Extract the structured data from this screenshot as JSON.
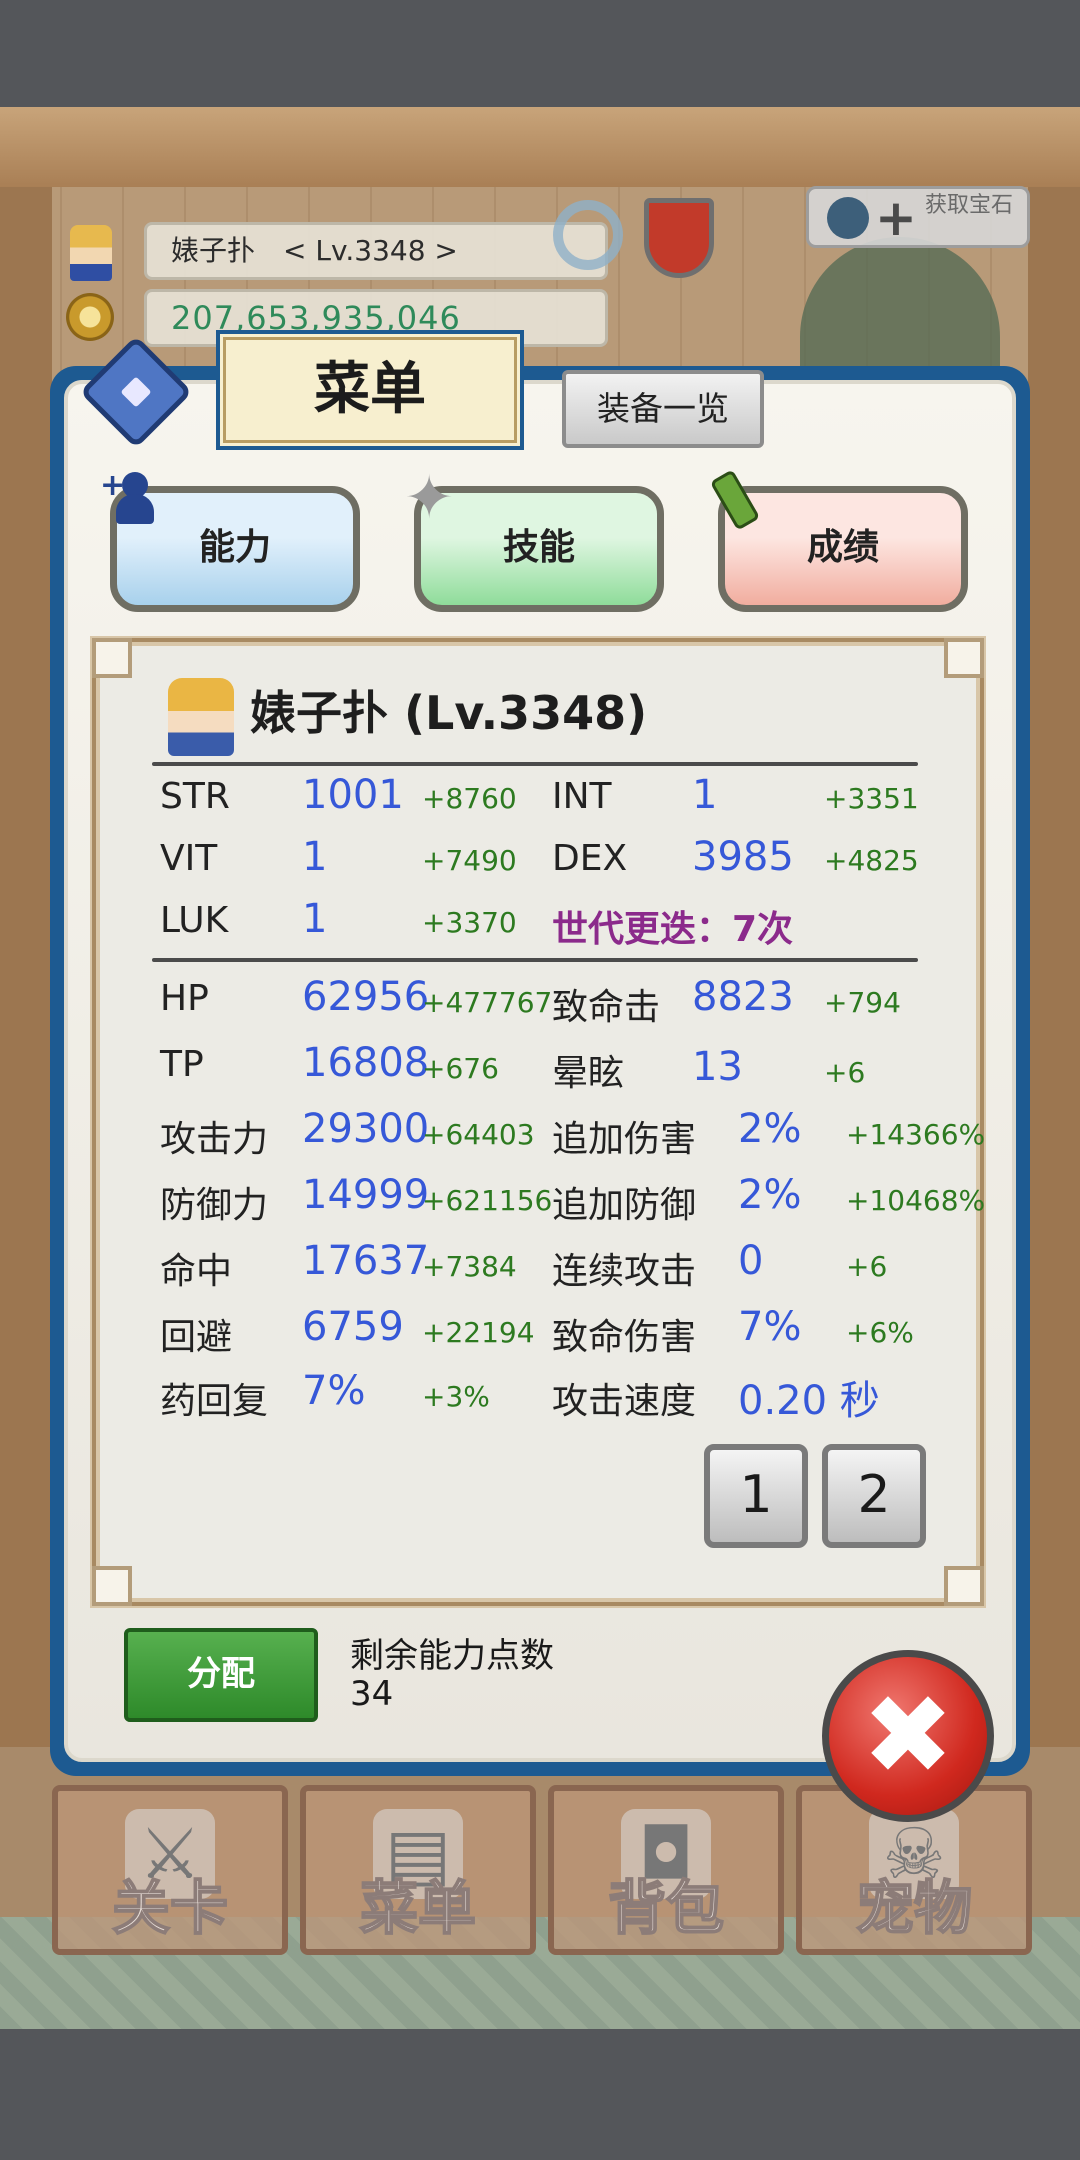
{
  "hud": {
    "player_name": "婊子扑　< Lv.3348 >",
    "gold": "207,653,935,046",
    "gem_button_label": "获取宝石"
  },
  "menu": {
    "title": "菜单",
    "equip_list_button": "装备一览",
    "tabs": [
      {
        "label": "能力"
      },
      {
        "label": "技能"
      },
      {
        "label": "成绩"
      }
    ]
  },
  "character": {
    "title": "婊子扑 (Lv.3348)"
  },
  "stats": {
    "str": {
      "label": "STR",
      "value": "1001",
      "bonus": "+8760"
    },
    "int": {
      "label": "INT",
      "value": "1",
      "bonus": "+3351"
    },
    "vit": {
      "label": "VIT",
      "value": "1",
      "bonus": "+7490"
    },
    "dex": {
      "label": "DEX",
      "value": "3985",
      "bonus": "+4825"
    },
    "luk": {
      "label": "LUK",
      "value": "1",
      "bonus": "+3370"
    },
    "generation": "世代更迭：7次",
    "hp": {
      "label": "HP",
      "value": "62956",
      "bonus": "+477767"
    },
    "crit": {
      "label": "致命击",
      "value": "8823",
      "bonus": "+794"
    },
    "tp": {
      "label": "TP",
      "value": "16808",
      "bonus": "+676"
    },
    "stun": {
      "label": "晕眩",
      "value": "13",
      "bonus": "+6"
    },
    "atk": {
      "label": "攻击力",
      "value": "29300",
      "bonus": "+64403"
    },
    "extra_dmg": {
      "label": "追加伤害",
      "value": "2%",
      "bonus": "+14366%"
    },
    "def": {
      "label": "防御力",
      "value": "14999",
      "bonus": "+621156"
    },
    "extra_def": {
      "label": "追加防御",
      "value": "2%",
      "bonus": "+10468%"
    },
    "hit": {
      "label": "命中",
      "value": "17637",
      "bonus": "+7384"
    },
    "combo": {
      "label": "连续攻击",
      "value": "0",
      "bonus": "+6"
    },
    "evade": {
      "label": "回避",
      "value": "6759",
      "bonus": "+22194"
    },
    "crit_dmg": {
      "label": "致命伤害",
      "value": "7%",
      "bonus": "+6%"
    },
    "potion": {
      "label": "药回复",
      "value": "7%",
      "bonus": "+3%"
    },
    "atk_speed": {
      "label": "攻击速度",
      "value": "0.20 秒"
    }
  },
  "pages": [
    "1",
    "2"
  ],
  "allot_button": "分配",
  "remaining": {
    "label": "剩余能力点数",
    "value": "34"
  },
  "close_glyph": "✖",
  "bottom_nav": [
    {
      "label": "关卡",
      "icon": "crossed-swords-icon"
    },
    {
      "label": "菜单",
      "icon": "book-icon"
    },
    {
      "label": "背包",
      "icon": "backpack-icon"
    },
    {
      "label": "宠物",
      "icon": "skull-icon"
    }
  ]
}
